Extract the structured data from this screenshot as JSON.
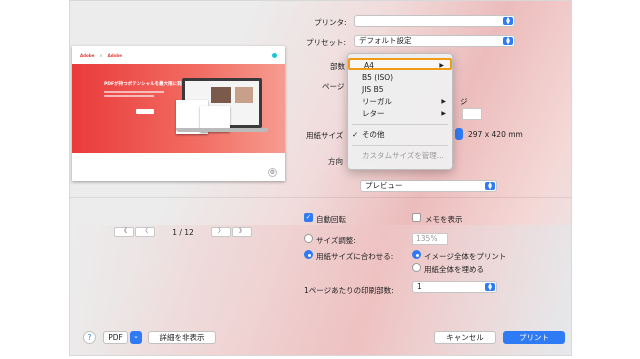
{
  "print": {
    "printer_label": "プリンタ:",
    "printer_value": "",
    "preset_label": "プリセット:",
    "preset_value": "デフォルト設定",
    "copies_label": "部数",
    "pages_label": "ページ",
    "pages_right": "ジ",
    "paper_label": "用紙サイズ",
    "paper_dim": "297 x 420 mm",
    "orientation_label": "方向",
    "section_value": "プレビュー"
  },
  "menu": {
    "items": [
      {
        "label": "A4",
        "submenu": "▶"
      },
      {
        "label": "B5 (ISO)",
        "submenu": ""
      },
      {
        "label": "JIS B5",
        "submenu": ""
      },
      {
        "label": "リーガル",
        "submenu": "▶"
      },
      {
        "label": "レター",
        "submenu": "▶"
      },
      {
        "label": "その他",
        "check": "✓"
      },
      {
        "label": "カスタムサイズを管理..."
      }
    ]
  },
  "preview": {
    "logo_left": "Adobe",
    "logo_x": "×",
    "logo_right": "Adobe",
    "hero_title": "PDFが持つポテンシャルを最大限に発揮"
  },
  "pager": {
    "first": "《",
    "prev": "〈",
    "text": "1 / 12",
    "next": "〉",
    "last": "》"
  },
  "options": {
    "auto_rotate": "自動回転",
    "show_notes": "メモを表示",
    "scale_label": "サイズ調整:",
    "scale_value": "135%",
    "fit_label": "用紙サイズに合わせる:",
    "fit_opt1": "イメージ全体をプリント",
    "fit_opt2": "用紙全体を埋める",
    "pps_label": "1ページあたりの印刷部数:",
    "pps_value": "1"
  },
  "footer": {
    "help": "?",
    "pdf": "PDF",
    "pdf_arrow": "⌄",
    "details": "詳細を非表示",
    "cancel": "キャンセル",
    "print": "プリント"
  }
}
